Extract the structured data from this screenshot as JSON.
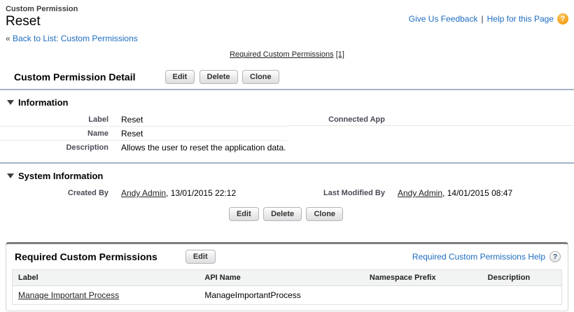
{
  "header": {
    "entity_type": "Custom Permission",
    "title": "Reset",
    "back_arrow": "«",
    "back_link": "Back to List: Custom Permissions",
    "feedback_link": "Give Us Feedback",
    "separator": "|",
    "help_link": "Help for this Page",
    "help_glyph": "?"
  },
  "jump_links": {
    "label": "Required Custom Permissions",
    "count": "[1]"
  },
  "detail": {
    "title": "Custom Permission Detail",
    "buttons": {
      "edit": "Edit",
      "delete": "Delete",
      "clone": "Clone"
    },
    "information": {
      "title": "Information",
      "label_field": {
        "label": "Label",
        "value": "Reset"
      },
      "name_field": {
        "label": "Name",
        "value": "Reset"
      },
      "description_field": {
        "label": "Description",
        "value": "Allows the user to reset the application data."
      },
      "connected_app_field": {
        "label": "Connected App",
        "value": ""
      }
    },
    "system_information": {
      "title": "System Information",
      "created_by": {
        "label": "Created By",
        "user": "Andy Admin",
        "datetime": ", 13/01/2015 22:12"
      },
      "last_modified_by": {
        "label": "Last Modified By",
        "user": "Andy Admin",
        "datetime": ", 14/01/2015 08:47"
      }
    }
  },
  "related_list": {
    "title": "Required Custom Permissions",
    "edit_button": "Edit",
    "help_link": "Required Custom Permissions Help",
    "help_glyph": "?",
    "columns": {
      "label": "Label",
      "api_name": "API Name",
      "namespace_prefix": "Namespace Prefix",
      "description": "Description"
    },
    "rows": [
      {
        "label": "Manage Important Process",
        "api_name": "ManageImportantProcess",
        "namespace_prefix": "",
        "description": ""
      }
    ]
  },
  "colors": {
    "link_blue": "#1d6cbf",
    "section_bar": "#a4b3c8",
    "help_orb_orange": "#f59300"
  }
}
